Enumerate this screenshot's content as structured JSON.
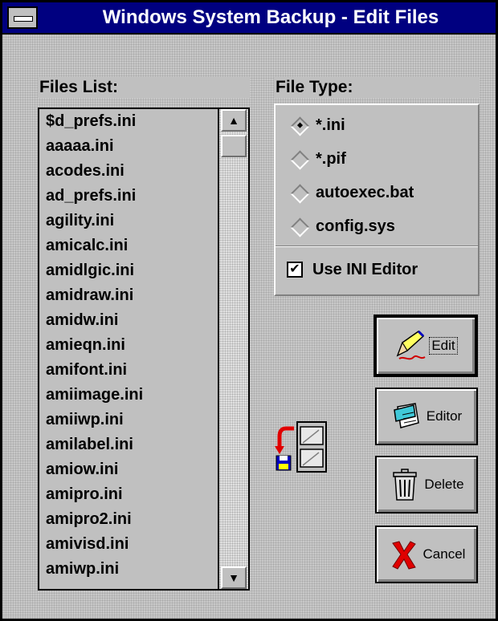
{
  "window": {
    "title": "Windows System Backup - Edit  Files"
  },
  "files": {
    "label": "Files List:",
    "items": [
      "$d_prefs.ini",
      "aaaaa.ini",
      "acodes.ini",
      "ad_prefs.ini",
      "agility.ini",
      "amicalc.ini",
      "amidlgic.ini",
      "amidraw.ini",
      "amidw.ini",
      "amieqn.ini",
      "amifont.ini",
      "amiimage.ini",
      "amiiwp.ini",
      "amilabel.ini",
      "amiow.ini",
      "amipro.ini",
      "amipro2.ini",
      "amivisd.ini",
      "amiwp.ini"
    ]
  },
  "file_type": {
    "label": "File Type:",
    "options": [
      "*.ini",
      "*.pif",
      "autoexec.bat",
      "config.sys"
    ],
    "selected": "*.ini",
    "use_ini_editor": {
      "label": "Use INI Editor",
      "checked": true
    }
  },
  "buttons": {
    "edit": "Edit",
    "editor": "Editor",
    "delete": "Delete",
    "cancel": "Cancel"
  },
  "icons": {
    "edit": "pencil-icon",
    "editor": "notepad-icon",
    "delete": "trash-can-icon",
    "cancel": "red-x-icon",
    "scroll_up": "arrow-up-icon",
    "scroll_down": "arrow-down-icon",
    "decor": "backup-restore-icon"
  },
  "colors": {
    "title_bar": "#000080",
    "title_text": "#ffffff",
    "face": "#c0c0c0"
  }
}
